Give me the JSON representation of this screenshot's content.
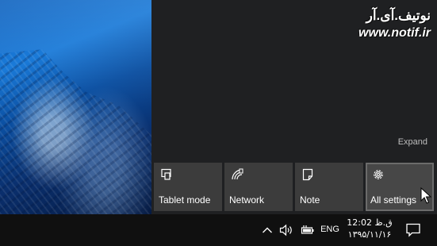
{
  "watermark": {
    "line1": "نوتیف.آی.آر",
    "line2": "www.notif.ir"
  },
  "action_center": {
    "expand_label": "Expand",
    "tiles": [
      {
        "label": "Tablet mode",
        "icon": "tablet-mode-icon"
      },
      {
        "label": "Network",
        "icon": "network-icon"
      },
      {
        "label": "Note",
        "icon": "note-icon"
      },
      {
        "label": "All settings",
        "icon": "gear-icon"
      }
    ]
  },
  "taskbar": {
    "language": "ENG",
    "time": "ق.ظ 12:02",
    "date": "۱۳۹۵/۱۱/۱۶",
    "icons": [
      "chevron-up-icon",
      "volume-icon",
      "battery-icon",
      "action-center-icon"
    ]
  },
  "colors": {
    "panel_bg": "#1f2022",
    "tile_bg": "#3c3c3c",
    "taskbar_bg": "#101010",
    "text": "#ffffff",
    "expand_text": "#bdbdbd"
  }
}
